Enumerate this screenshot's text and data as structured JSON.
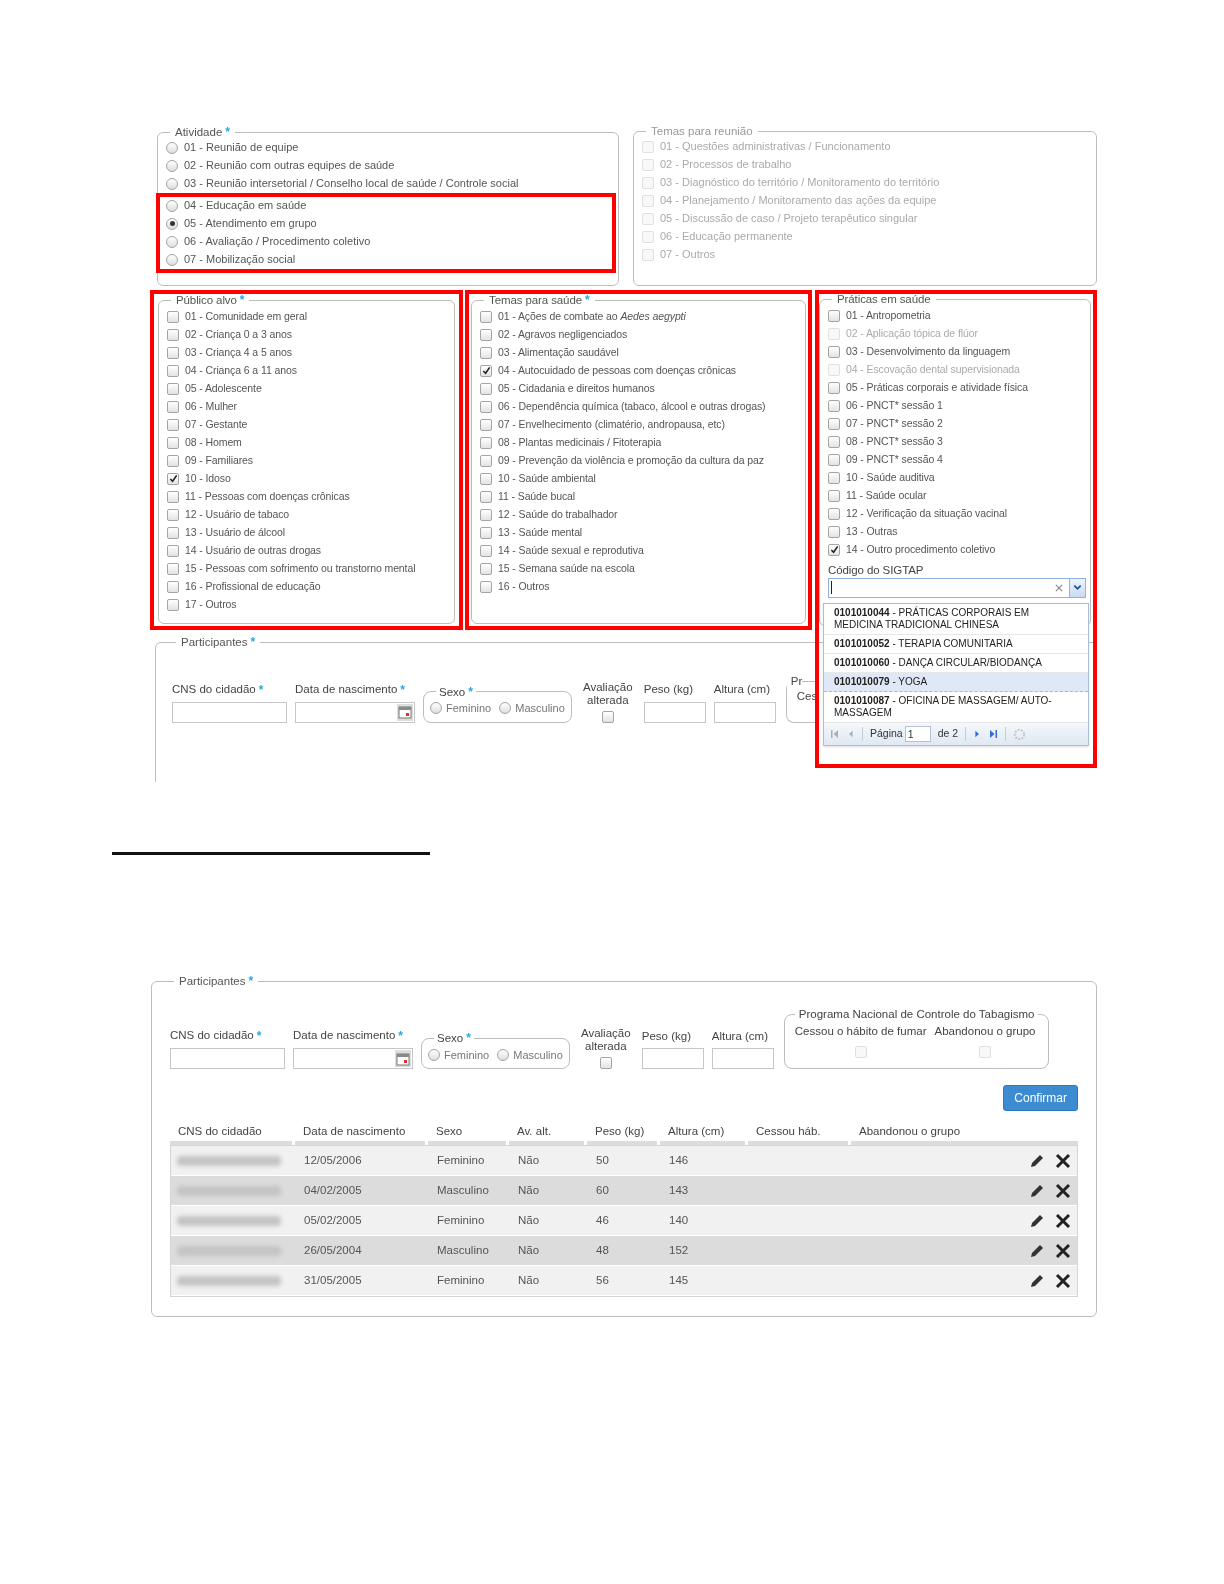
{
  "top_screen": {
    "atividade": {
      "legend": "Atividade",
      "asterisk": "*",
      "options": [
        {
          "label": "01 - Reunião de equipe",
          "selected": false,
          "highlighted": false
        },
        {
          "label": "02 - Reunião com outras equipes de saúde",
          "selected": false,
          "highlighted": false
        },
        {
          "label": "03 - Reunião intersetorial / Conselho local de saúde / Controle social",
          "selected": false,
          "highlighted": false
        },
        {
          "label": "04 - Educação em saúde",
          "selected": false,
          "highlighted": true
        },
        {
          "label": "05 - Atendimento em grupo",
          "selected": true,
          "highlighted": true
        },
        {
          "label": "06 - Avaliação / Procedimento coletivo",
          "selected": false,
          "highlighted": true
        },
        {
          "label": "07 - Mobilização social",
          "selected": false,
          "highlighted": true
        }
      ]
    },
    "temas_reuniao": {
      "legend": "Temas para reunião",
      "options": [
        {
          "label": "01 - Questões administrativas / Funcionamento",
          "checked": false,
          "disabled": true
        },
        {
          "label": "02 - Processos de trabalho",
          "checked": false,
          "disabled": true
        },
        {
          "label": "03 - Diagnóstico do território / Monitoramento do território",
          "checked": false,
          "disabled": true
        },
        {
          "label": "04 - Planejamento / Monitoramento das ações da equipe",
          "checked": false,
          "disabled": true
        },
        {
          "label": "05 - Discussão de caso / Projeto terapêutico singular",
          "checked": false,
          "disabled": true
        },
        {
          "label": "06 - Educação permanente",
          "checked": false,
          "disabled": true
        },
        {
          "label": "07 - Outros",
          "checked": false,
          "disabled": true
        }
      ]
    },
    "publico_alvo": {
      "legend": "Público alvo",
      "asterisk": "*",
      "highlighted": true,
      "options": [
        {
          "label": "01 - Comunidade em geral",
          "checked": false,
          "disabled": false
        },
        {
          "label": "02 - Criança 0 a 3 anos",
          "checked": false,
          "disabled": false
        },
        {
          "label": "03 - Criança 4 a 5 anos",
          "checked": false,
          "disabled": false
        },
        {
          "label": "04 - Criança 6 a 11 anos",
          "checked": false,
          "disabled": false
        },
        {
          "label": "05 - Adolescente",
          "checked": false,
          "disabled": false
        },
        {
          "label": "06 - Mulher",
          "checked": false,
          "disabled": false
        },
        {
          "label": "07 - Gestante",
          "checked": false,
          "disabled": false
        },
        {
          "label": "08 - Homem",
          "checked": false,
          "disabled": false
        },
        {
          "label": "09 - Familiares",
          "checked": false,
          "disabled": false
        },
        {
          "label": "10 - Idoso",
          "checked": true,
          "disabled": false
        },
        {
          "label": "11 - Pessoas com doenças crônicas",
          "checked": false,
          "disabled": false
        },
        {
          "label": "12 - Usuário de tabaco",
          "checked": false,
          "disabled": false
        },
        {
          "label": "13 - Usuário de álcool",
          "checked": false,
          "disabled": false
        },
        {
          "label": "14 - Usuário de outras drogas",
          "checked": false,
          "disabled": false
        },
        {
          "label": "15 - Pessoas com sofrimento ou transtorno mental",
          "checked": false,
          "disabled": false
        },
        {
          "label": "16 - Profissional de educação",
          "checked": false,
          "disabled": false
        },
        {
          "label": "17 - Outros",
          "checked": false,
          "disabled": false
        }
      ]
    },
    "temas_saude": {
      "legend": "Temas para saúde",
      "asterisk": "*",
      "highlighted": true,
      "options": [
        {
          "label": "01 - Ações de combate ao *Aedes aegypti*",
          "checked": false,
          "disabled": false
        },
        {
          "label": "02 - Agravos negligenciados",
          "checked": false,
          "disabled": false
        },
        {
          "label": "03 - Alimentação saudável",
          "checked": false,
          "disabled": false
        },
        {
          "label": "04 - Autocuidado de pessoas com doenças crônicas",
          "checked": true,
          "disabled": false
        },
        {
          "label": "05 - Cidadania e direitos humanos",
          "checked": false,
          "disabled": false
        },
        {
          "label": "06 - Dependência química (tabaco, álcool e outras drogas)",
          "checked": false,
          "disabled": false
        },
        {
          "label": "07 - Envelhecimento (climatério, andropausa, etc)",
          "checked": false,
          "disabled": false
        },
        {
          "label": "08 - Plantas medicinais / Fitoterapia",
          "checked": false,
          "disabled": false
        },
        {
          "label": "09 - Prevenção da violência e promoção da cultura da paz",
          "checked": false,
          "disabled": false
        },
        {
          "label": "10 - Saúde ambiental",
          "checked": false,
          "disabled": false
        },
        {
          "label": "11 - Saúde bucal",
          "checked": false,
          "disabled": false
        },
        {
          "label": "12 - Saúde do trabalhador",
          "checked": false,
          "disabled": false
        },
        {
          "label": "13 - Saúde mental",
          "checked": false,
          "disabled": false
        },
        {
          "label": "14 - Saúde sexual e reprodutiva",
          "checked": false,
          "disabled": false
        },
        {
          "label": "15 - Semana saúde na escola",
          "checked": false,
          "disabled": false
        },
        {
          "label": "16 - Outros",
          "checked": false,
          "disabled": false
        }
      ]
    },
    "praticas_saude": {
      "legend": "Práticas em saúde",
      "highlighted": true,
      "options": [
        {
          "label": "01 - Antropometria",
          "checked": false,
          "disabled": false
        },
        {
          "label": "02 - Aplicação tópica de flúor",
          "checked": false,
          "disabled": true
        },
        {
          "label": "03 - Desenvolvimento da linguagem",
          "checked": false,
          "disabled": false
        },
        {
          "label": "04 - Escovação dental supervisionada",
          "checked": false,
          "disabled": true
        },
        {
          "label": "05 - Práticas corporais e atividade física",
          "checked": false,
          "disabled": false
        },
        {
          "label": "06 - PNCT* sessão 1",
          "checked": false,
          "disabled": false
        },
        {
          "label": "07 - PNCT* sessão 2",
          "checked": false,
          "disabled": false
        },
        {
          "label": "08 - PNCT* sessão 3",
          "checked": false,
          "disabled": false
        },
        {
          "label": "09 - PNCT* sessão 4",
          "checked": false,
          "disabled": false
        },
        {
          "label": "10 - Saúde auditiva",
          "checked": false,
          "disabled": false
        },
        {
          "label": "11 - Saúde ocular",
          "checked": false,
          "disabled": false
        },
        {
          "label": "12 - Verificação da situação vacinal",
          "checked": false,
          "disabled": false
        },
        {
          "label": "13 - Outras",
          "checked": false,
          "disabled": false
        },
        {
          "label": "14 - Outro procedimento coletivo",
          "checked": true,
          "disabled": false
        }
      ],
      "sigtap": {
        "label": "Código do SIGTAP",
        "results": [
          {
            "label": "**0101010044** - PRÁTICAS CORPORAIS EM MEDICINA TRADICIONAL CHINESA",
            "selected": false
          },
          {
            "label": "**0101010052** - TERAPIA COMUNITARIA",
            "selected": false
          },
          {
            "label": "**0101010060** - DANÇA CIRCULAR/BIODANÇA",
            "selected": false
          },
          {
            "label": "**0101010079** - YOGA",
            "selected": true
          },
          {
            "label": "**0101010087** - OFICINA DE MASSAGEM/ AUTO-MASSAGEM",
            "selected": false
          }
        ],
        "pager": {
          "page_label": "Página",
          "page": "1",
          "of": "de 2"
        }
      }
    },
    "participantes": {
      "legend": "Participantes",
      "asterisk": "*",
      "fields": [
        {
          "kind": "text",
          "label": "CNS do cidadão",
          "asterisk": "*"
        },
        {
          "kind": "date",
          "label": "Data de nascimento",
          "asterisk": "*"
        },
        {
          "kind": "radio",
          "label": "Sexo",
          "asterisk": "*",
          "options": [
            {
              "label": "Feminino",
              "selected": false
            },
            {
              "label": "Masculino",
              "selected": false
            }
          ]
        },
        {
          "kind": "checkbox",
          "label": "Avaliação alterada",
          "checked": false
        },
        {
          "kind": "text",
          "label": "Peso (kg)"
        },
        {
          "kind": "text",
          "label": "Altura (cm)"
        }
      ],
      "tabagismo_legend": "Pr",
      "tabagismo_label": "Ces"
    }
  },
  "bottom_screen": {
    "participantes": {
      "legend": "Participantes",
      "asterisk": "*",
      "fields": [
        {
          "kind": "text",
          "label": "CNS do cidadão",
          "asterisk": "*"
        },
        {
          "kind": "date",
          "label": "Data de nascimento",
          "asterisk": "*"
        },
        {
          "kind": "radio",
          "label": "Sexo",
          "asterisk": "*",
          "options": [
            {
              "label": "Feminino",
              "selected": false
            },
            {
              "label": "Masculino",
              "selected": false
            }
          ]
        },
        {
          "kind": "checkbox",
          "label": "Avaliação alterada",
          "checked": false
        },
        {
          "kind": "text",
          "label": "Peso (kg)"
        },
        {
          "kind": "text",
          "label": "Altura (cm)"
        }
      ],
      "tabagismo": {
        "legend": "Programa Nacional de Controle do Tabagismo",
        "options": [
          {
            "label": "Cessou o hábito de fumar",
            "checked": false,
            "disabled": true
          },
          {
            "label": "Abandonou o grupo",
            "checked": false,
            "disabled": true
          }
        ]
      },
      "confirm": "Confirmar",
      "table": {
        "columns": [
          "CNS do cidadão",
          "Data de nascimento",
          "Sexo",
          "Av. alt.",
          "Peso (kg)",
          "Altura (cm)",
          "Cessou háb.",
          "Abandonou o grupo"
        ],
        "rows": [
          {
            "cells": [
              "",
              "12/05/2006",
              "Feminino",
              "Não",
              "50",
              "146"
            ]
          },
          {
            "cells": [
              "",
              "04/02/2005",
              "Masculino",
              "Não",
              "60",
              "143"
            ]
          },
          {
            "cells": [
              "",
              "05/02/2005",
              "Feminino",
              "Não",
              "46",
              "140"
            ]
          },
          {
            "cells": [
              "",
              "26/05/2004",
              "Masculino",
              "Não",
              "48",
              "152"
            ]
          },
          {
            "cells": [
              "",
              "31/05/2005",
              "Feminino",
              "Não",
              "56",
              "145"
            ]
          }
        ]
      }
    }
  }
}
